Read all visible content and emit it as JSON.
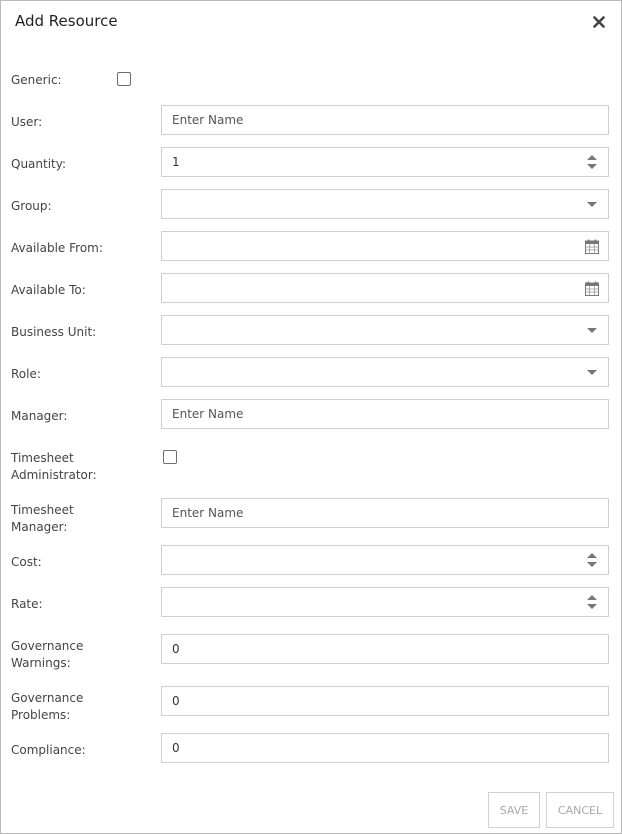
{
  "dialog": {
    "title": "Add Resource"
  },
  "icons": {
    "close": "close-icon",
    "spinner": "spinner-icon",
    "dropdown": "chevron-down-icon",
    "calendar": "calendar-icon"
  },
  "colors": {
    "border": "#cfcfcf",
    "icon": "#777777",
    "button_text": "#a8a8a8"
  },
  "form": {
    "generic": {
      "label": "Generic:",
      "checked": false
    },
    "user": {
      "label": "User:",
      "value": "",
      "placeholder": "Enter Name"
    },
    "quantity": {
      "label": "Quantity:",
      "value": "1"
    },
    "group": {
      "label": "Group:",
      "value": ""
    },
    "available_from": {
      "label": "Available From:",
      "value": ""
    },
    "available_to": {
      "label": "Available To:",
      "value": ""
    },
    "business_unit": {
      "label": "Business Unit:",
      "value": ""
    },
    "role": {
      "label": "Role:",
      "value": ""
    },
    "manager": {
      "label": "Manager:",
      "value": "",
      "placeholder": "Enter Name"
    },
    "timesheet_administrator": {
      "label_line1": "Timesheet",
      "label_line2": "Administrator:",
      "checked": false
    },
    "timesheet_manager": {
      "label_line1": "Timesheet",
      "label_line2": "Manager:",
      "value": "",
      "placeholder": "Enter Name"
    },
    "cost": {
      "label": "Cost:",
      "value": ""
    },
    "rate": {
      "label": "Rate:",
      "value": ""
    },
    "governance_warnings": {
      "label_line1": "Governance",
      "label_line2": "Warnings:",
      "value": "0"
    },
    "governance_problems": {
      "label_line1": "Governance",
      "label_line2": "Problems:",
      "value": "0"
    },
    "compliance": {
      "label": "Compliance:",
      "value": "0"
    }
  },
  "footer": {
    "save_label": "SAVE",
    "cancel_label": "CANCEL"
  }
}
